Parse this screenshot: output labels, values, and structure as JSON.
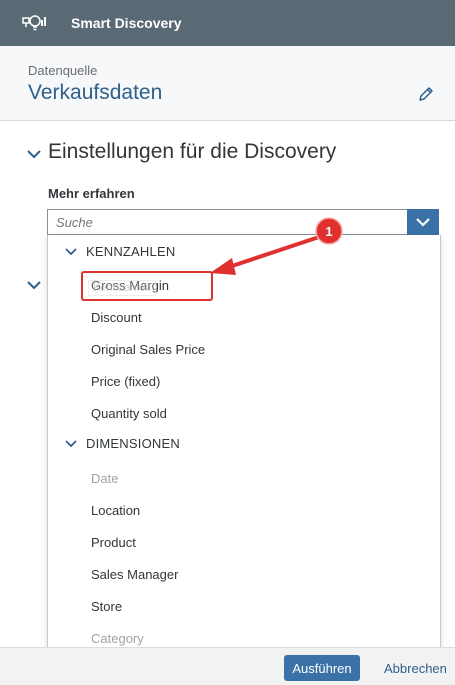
{
  "app": {
    "title": "Smart Discovery",
    "icon": "smart-discovery-icon"
  },
  "header": {
    "source_label": "Datenquelle",
    "source_name": "Verkaufsdaten",
    "edit_icon": "pencil-icon"
  },
  "settings": {
    "title": "Einstellungen für die Discovery",
    "more_label": "Mehr erfahren"
  },
  "search": {
    "placeholder": "Suche"
  },
  "dropdown": {
    "groups": [
      {
        "label": "KENNZAHLEN",
        "items": [
          {
            "label": "Gross Margin",
            "disabled": false
          },
          {
            "label": "Discount",
            "disabled": false
          },
          {
            "label": "Original Sales Price",
            "disabled": false
          },
          {
            "label": "Price (fixed)",
            "disabled": false
          },
          {
            "label": "Quantity sold",
            "disabled": false
          }
        ]
      },
      {
        "label": "DIMENSIONEN",
        "items": [
          {
            "label": "Date",
            "disabled": true
          },
          {
            "label": "Location",
            "disabled": false
          },
          {
            "label": "Product",
            "disabled": false
          },
          {
            "label": "Sales Manager",
            "disabled": false
          },
          {
            "label": "Store",
            "disabled": false
          },
          {
            "label": "Category",
            "disabled": true
          }
        ]
      }
    ]
  },
  "annotation": {
    "number": "1",
    "tooltip_ghost": "Kennzahlen",
    "color": "#e03030"
  },
  "footer": {
    "run_label": "Ausführen",
    "cancel_label": "Abbrechen"
  },
  "colors": {
    "titlebar": "#5a6a75",
    "accent": "#3a72a8",
    "link": "#2f5f8c",
    "annotation": "#e03030"
  }
}
